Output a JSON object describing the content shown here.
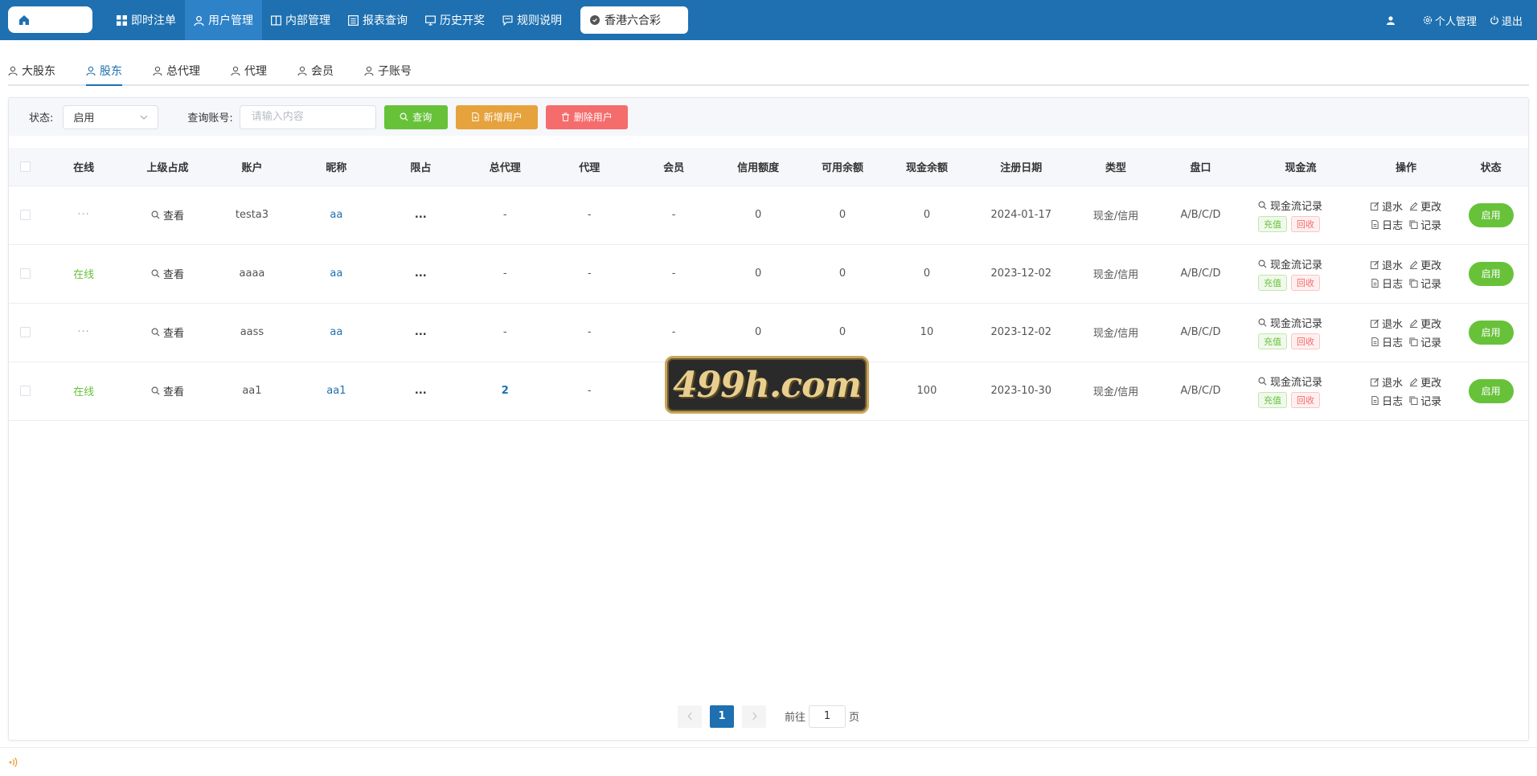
{
  "nav": {
    "items": [
      {
        "label": "即时注单",
        "icon": "grid-icon"
      },
      {
        "label": "用户管理",
        "icon": "user-icon"
      },
      {
        "label": "内部管理",
        "icon": "book-icon"
      },
      {
        "label": "报表查询",
        "icon": "report-icon"
      },
      {
        "label": "历史开奖",
        "icon": "monitor-icon"
      },
      {
        "label": "规则说明",
        "icon": "chat-icon"
      }
    ],
    "active_index": 1,
    "lottery": "香港六合彩",
    "personal": "个人管理",
    "logout": "退出"
  },
  "subtabs": [
    "大股东",
    "股东",
    "总代理",
    "代理",
    "会员",
    "子账号"
  ],
  "subtab_active": 1,
  "filter": {
    "status_label": "状态:",
    "status_value": "启用",
    "account_label": "查询账号:",
    "account_placeholder": "请输入内容",
    "search_btn": "查询",
    "add_btn": "新增用户",
    "delete_btn": "删除用户"
  },
  "table": {
    "headers": [
      "在线",
      "上级占成",
      "账户",
      "昵称",
      "限占",
      "总代理",
      "代理",
      "会员",
      "信用额度",
      "可用余额",
      "现金余额",
      "注册日期",
      "类型",
      "盘口",
      "现金流",
      "操作",
      "状态"
    ],
    "view_label": "查看",
    "cash_record": "现金流记录",
    "recharge": "充值",
    "recover": "回收",
    "op_rebate": "退水",
    "op_edit": "更改",
    "op_log": "日志",
    "op_record": "记录",
    "rows": [
      {
        "online": "···",
        "is_online": false,
        "account": "testa3",
        "nickname": "aa",
        "limit": "...",
        "general_agent": "-",
        "agent": "-",
        "member": "-",
        "credit": "0",
        "available": "0",
        "cash": "0",
        "reg_date": "2024-01-17",
        "type": "现金/信用",
        "plate": "A/B/C/D",
        "status": "启用"
      },
      {
        "online": "在线",
        "is_online": true,
        "account": "aaaa",
        "nickname": "aa",
        "limit": "...",
        "general_agent": "-",
        "agent": "-",
        "member": "-",
        "credit": "0",
        "available": "0",
        "cash": "0",
        "reg_date": "2023-12-02",
        "type": "现金/信用",
        "plate": "A/B/C/D",
        "status": "启用"
      },
      {
        "online": "···",
        "is_online": false,
        "account": "aass",
        "nickname": "aa",
        "limit": "...",
        "general_agent": "-",
        "agent": "-",
        "member": "-",
        "credit": "0",
        "available": "0",
        "cash": "10",
        "reg_date": "2023-12-02",
        "type": "现金/信用",
        "plate": "A/B/C/D",
        "status": "启用"
      },
      {
        "online": "在线",
        "is_online": true,
        "account": "aa1",
        "nickname": "aa1",
        "limit": "...",
        "general_agent": "2",
        "agent": "-",
        "member": "",
        "credit": "",
        "available": "",
        "cash": "100",
        "reg_date": "2023-10-30",
        "type": "现金/信用",
        "plate": "A/B/C/D",
        "status": "启用"
      }
    ]
  },
  "pager": {
    "current": "1",
    "goto_label": "前往",
    "goto_value": "1",
    "page_suffix": "页"
  },
  "watermark": "499h.com",
  "colors": {
    "primary": "#1e70b0",
    "success": "#67c23a",
    "warning": "#e6a23c",
    "danger": "#f56c6c"
  }
}
